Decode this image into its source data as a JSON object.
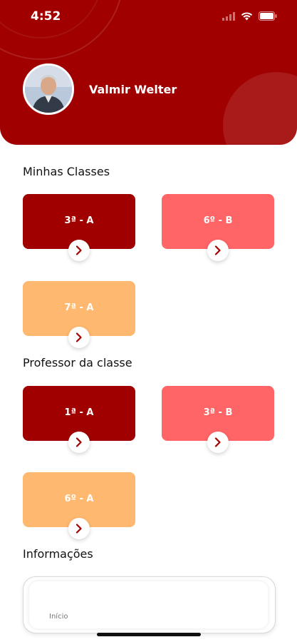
{
  "status_bar": {
    "time": "4:52"
  },
  "profile": {
    "name": "Valmir Welter"
  },
  "sections": {
    "my_classes": "Minhas Classes",
    "teacher_of_class": "Professor da classe",
    "information": "Informações"
  },
  "my_classes": [
    {
      "label": "3ª - A",
      "color": "#a00000"
    },
    {
      "label": "6º - B",
      "color": "#ff6467"
    },
    {
      "label": "7ª - A",
      "color": "#ffb870"
    }
  ],
  "teacher_classes": [
    {
      "label": "1ª - A",
      "color": "#a00000"
    },
    {
      "label": "3ª - B",
      "color": "#ff6467"
    },
    {
      "label": "6º - A",
      "color": "#ffb870"
    }
  ],
  "info": {
    "text": "Início"
  },
  "colors": {
    "header": "#a00000",
    "accent": "#a00000"
  }
}
